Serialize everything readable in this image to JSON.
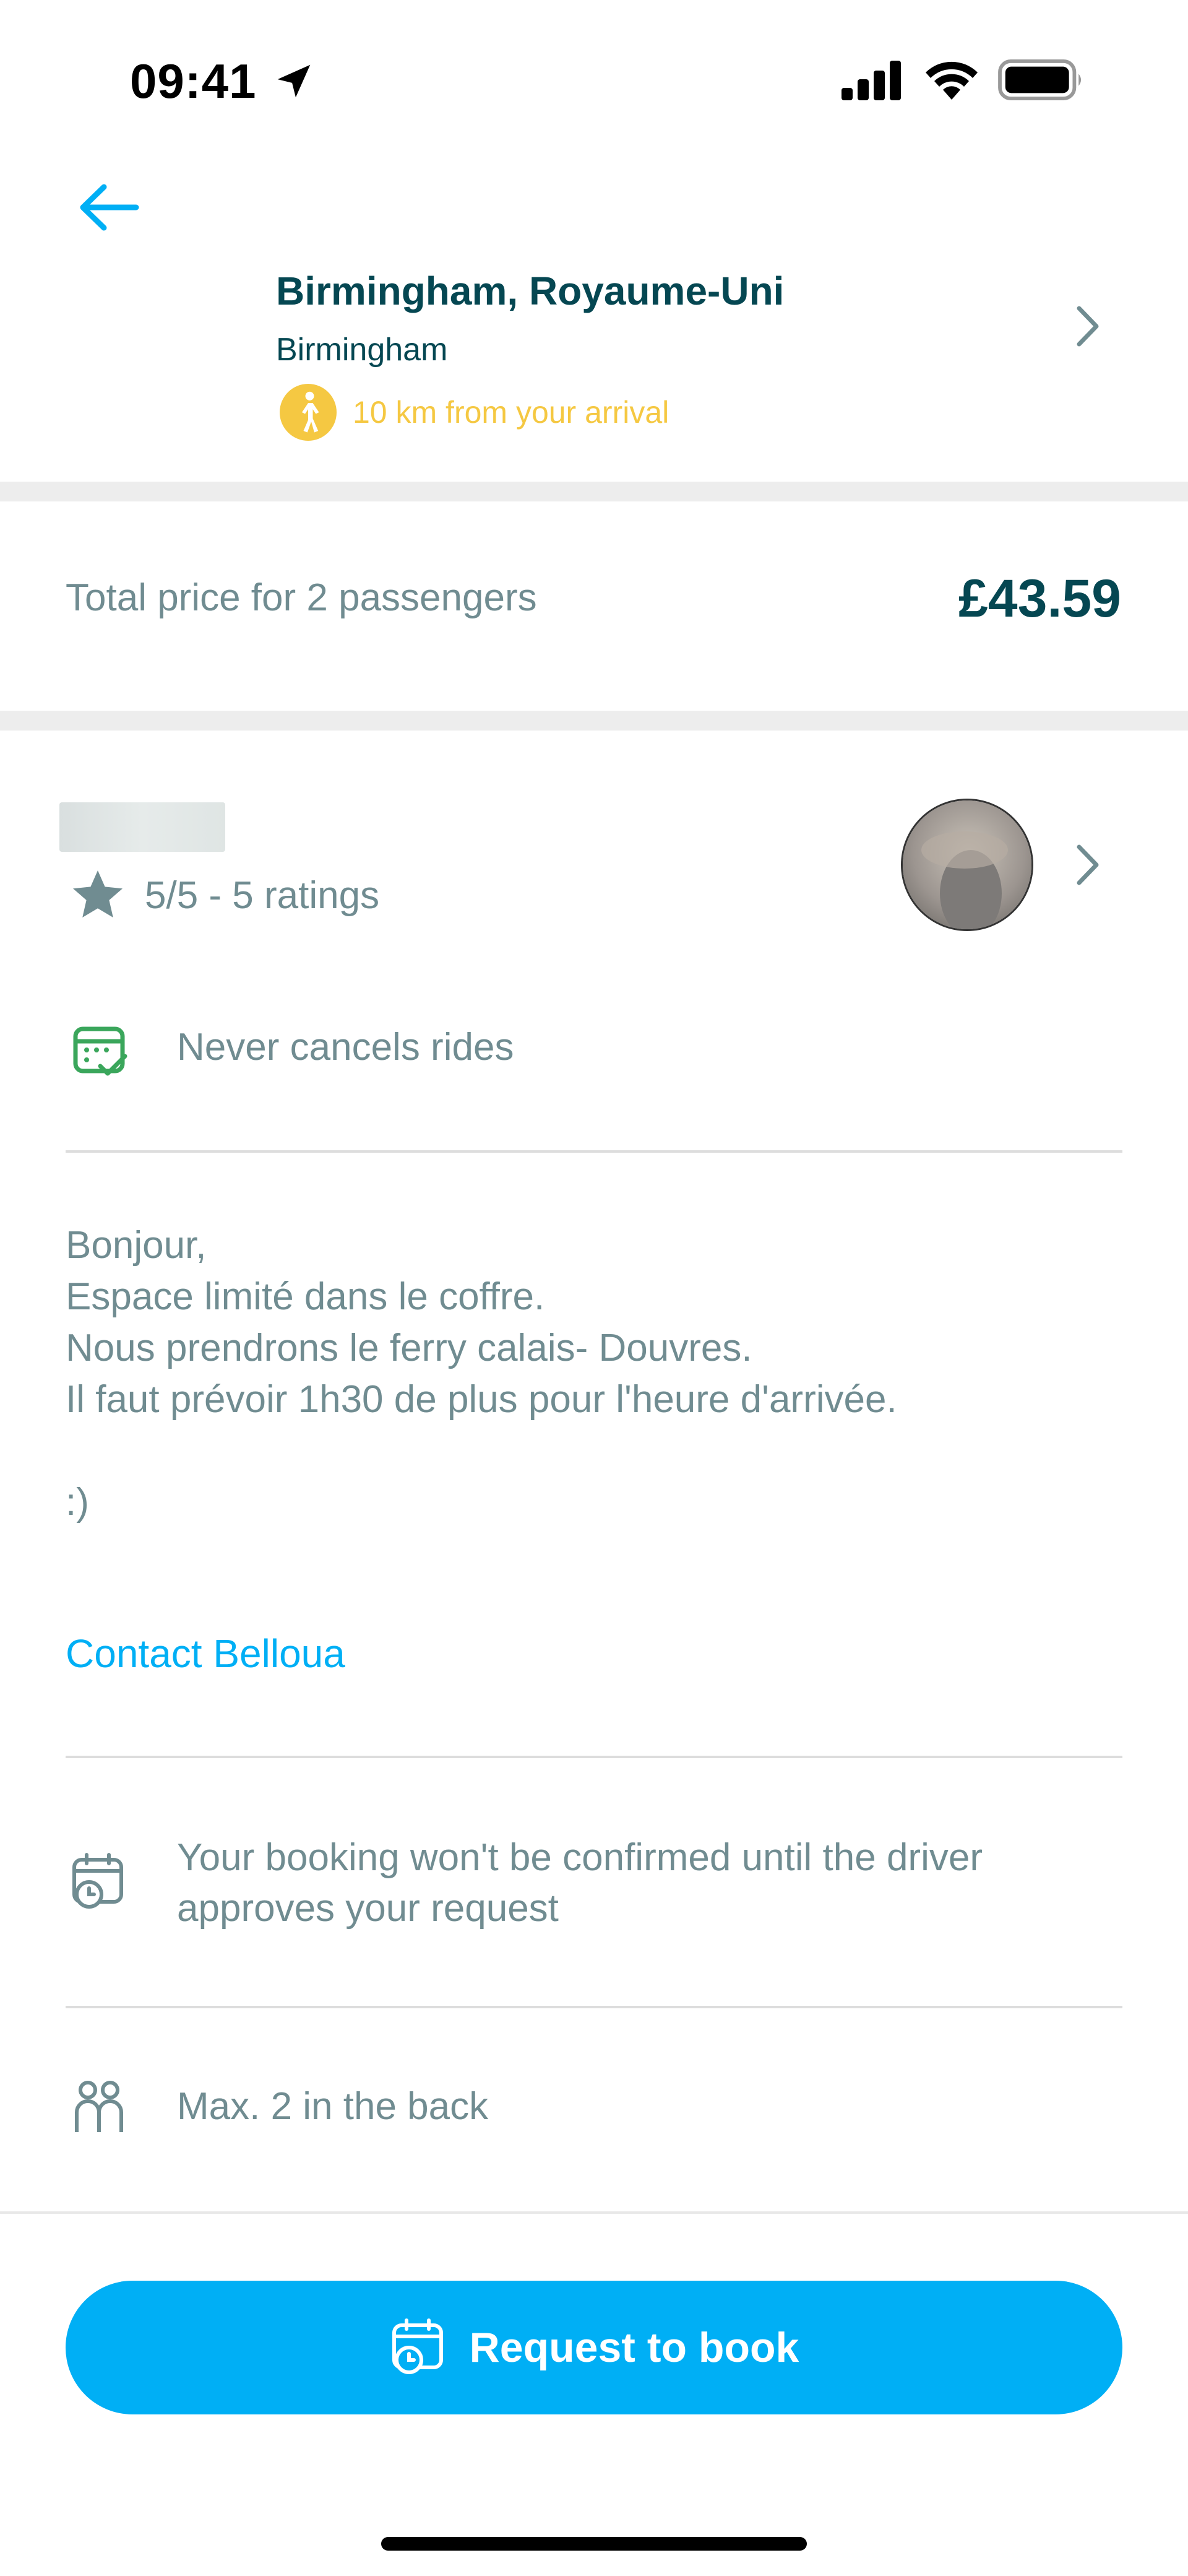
{
  "status_bar": {
    "time": "09:41"
  },
  "header": {
    "title": "Birmingham, Royaume-Uni",
    "subtitle": "Birmingham",
    "distance_note": "10 km from your arrival"
  },
  "price": {
    "label": "Total price for 2 passengers",
    "value": "£43.59"
  },
  "driver": {
    "rating": "5/5 - 5 ratings",
    "badge": "Never cancels rides"
  },
  "message": {
    "lines": [
      "Bonjour,",
      "Espace limité dans le coffre.",
      "Nous prendrons le ferry calais- Douvres.",
      "Il faut prévoir 1h30 de plus pour l'heure d'arrivée.",
      "",
      ":)"
    ],
    "contact_label": "Contact Belloua"
  },
  "info": {
    "approval_note": "Your booking won't be confirmed until the driver approves your request",
    "back_seats": "Max. 2 in the back"
  },
  "cta": {
    "label": "Request to book"
  },
  "colors": {
    "primary": "#00aff5",
    "dark_text": "#054752",
    "muted_text": "#708c91",
    "walk_accent": "#f5c842",
    "badge_green": "#3aa65b"
  }
}
